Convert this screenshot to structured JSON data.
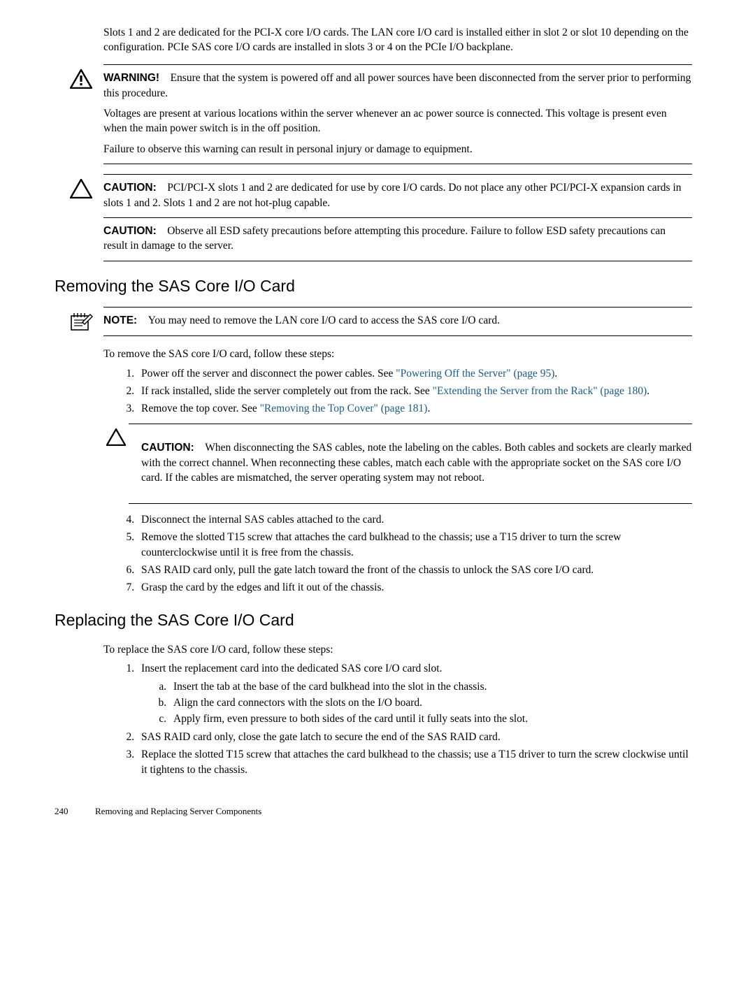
{
  "intro": "Slots 1 and 2 are dedicated for the PCI-X core I/O cards. The LAN core I/O card is installed either in slot 2 or slot 10 depending on the configuration. PCIe SAS core I/O cards are installed in slots 3 or 4 on the PCIe I/O backplane.",
  "warn": {
    "label": "WARNING!",
    "p1": "Ensure that the system is powered off and all power sources have been disconnected from the server prior to performing this procedure.",
    "p2": "Voltages are present at various locations within the server whenever an ac power source is connected. This voltage is present even when the main power switch is in the off position.",
    "p3": "Failure to observe this warning can result in personal injury or damage to equipment."
  },
  "caution1": {
    "label": "CAUTION:",
    "p1": "PCI/PCI-X slots 1 and 2 are dedicated for use by core I/O cards. Do not place any other PCI/PCI-X expansion cards in slots 1 and 2. Slots 1 and 2 are not hot-plug capable.",
    "p2": "Observe all ESD safety precautions before attempting this procedure. Failure to follow ESD safety precautions can result in damage to the server."
  },
  "section1": {
    "title": "Removing the SAS Core I/O Card",
    "note_label": "NOTE:",
    "note_text": "You may need to remove the LAN core I/O card to access the SAS core I/O card.",
    "lead": "To remove the SAS core I/O card, follow these steps:",
    "steps": {
      "s1a": "Power off the server and disconnect the power cables. See ",
      "s1b": "\"Powering Off the Server\" (page 95)",
      "s1c": ".",
      "s2a": "If rack installed, slide the server completely out from the rack. See ",
      "s2b": "\"Extending the Server from the Rack\" (page 180)",
      "s2c": ".",
      "s3a": "Remove the top cover. See ",
      "s3b": "\"Removing the Top Cover\" (page 181)",
      "s3c": "."
    },
    "caution": {
      "label": "CAUTION:",
      "text": "When disconnecting the SAS cables, note the labeling on the cables. Both cables and sockets are clearly marked with the correct channel. When reconnecting these cables, match each cable with the appropriate socket on the SAS core I/O card. If the cables are mismatched, the server operating system may not reboot."
    },
    "steps2": {
      "s4": "Disconnect the internal SAS cables attached to the card.",
      "s5": "Remove the slotted T15 screw that attaches the card bulkhead to the chassis; use a T15 driver to turn the screw counterclockwise until it is free from the chassis.",
      "s6": "SAS RAID card only, pull the gate latch toward the front of the chassis to unlock the SAS core I/O card.",
      "s7": "Grasp the card by the edges and lift it out of the chassis."
    }
  },
  "section2": {
    "title": "Replacing the SAS Core I/O Card",
    "lead": "To replace the SAS core I/O card, follow these steps:",
    "steps": {
      "s1": "Insert the replacement card into the dedicated SAS core I/O card slot.",
      "s1a": "Insert the tab at the base of the card bulkhead into the slot in the chassis.",
      "s1b": "Align the card connectors with the slots on the I/O board.",
      "s1c": "Apply firm, even pressure to both sides of the card until it fully seats into the slot.",
      "s2": "SAS RAID card only, close the gate latch to secure the end of the SAS RAID card.",
      "s3": "Replace the slotted T15 screw that attaches the card bulkhead to the chassis; use a T15 driver to turn the screw clockwise until it tightens to the chassis."
    }
  },
  "footer": {
    "page": "240",
    "title": "Removing and Replacing Server Components"
  }
}
